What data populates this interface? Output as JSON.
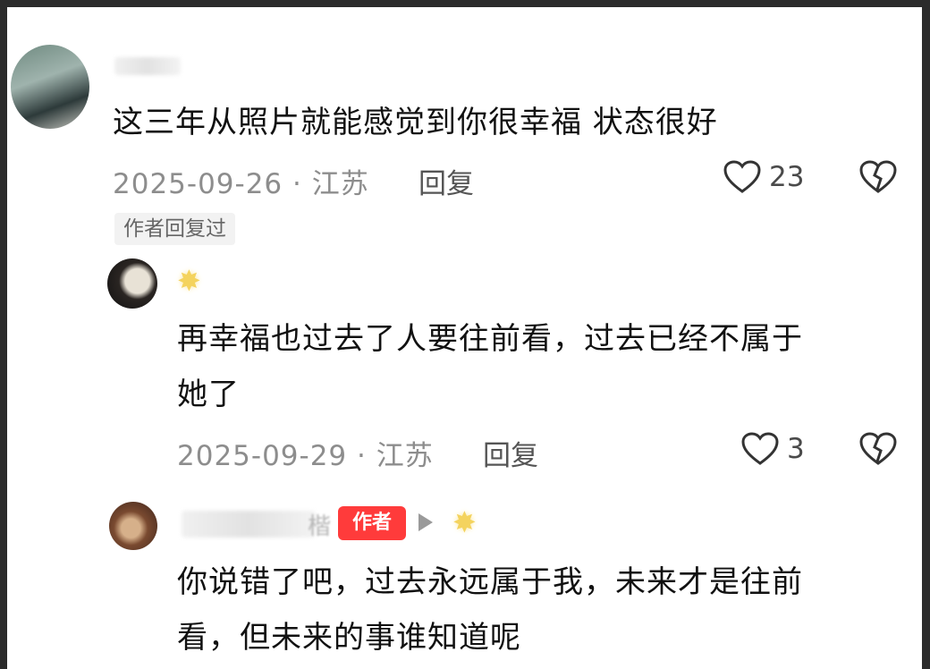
{
  "comments": [
    {
      "text": "这三年从照片就能感觉到你很幸福 状态很好",
      "meta": "2025-09-26 · 江苏",
      "reply_label": "回复",
      "likes": "23",
      "badge": "作者回复过"
    },
    {
      "text_line1": "再幸福也过去了人要往前看，过去已经不属于",
      "text_line2": "她了",
      "meta": "2025-09-29 · 江苏",
      "reply_label": "回复",
      "likes": "3"
    },
    {
      "author_badge": "作者",
      "text_line1": "你说错了吧，过去永远属于我，未来才是往前",
      "text_line2": "看，但未来的事谁知道呢"
    }
  ],
  "icons": {
    "like": "heart-outline-icon",
    "dislike": "broken-heart-icon",
    "star": "star-icon",
    "play": "play-triangle-icon"
  },
  "colors": {
    "author_badge_bg": "#ff3b3b",
    "meta_text": "#8d8d8d",
    "star": "#f4d35e"
  }
}
